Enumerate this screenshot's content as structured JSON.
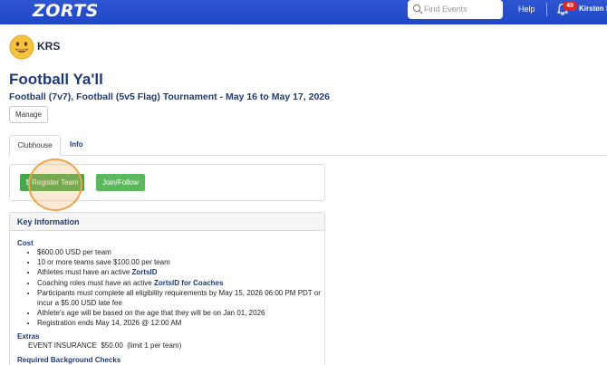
{
  "navbar": {
    "logo_text": "ZORTS",
    "search_placeholder": "Find Events",
    "help_label": "Help",
    "notification_count": "49",
    "username": "Kirsten S",
    "bg_color": "#2649c9"
  },
  "org": {
    "name": "KRS",
    "avatar_icon": "smiley-face-icon"
  },
  "event": {
    "title": "Football Ya'll",
    "subtitle": "Football (7v7), Football (5v5 Flag) Tournament  -  May 16 to May 17, 2026",
    "manage_label": "Manage"
  },
  "tabs": [
    {
      "label": "Clubhouse",
      "active": true
    },
    {
      "label": "Info",
      "active": false
    }
  ],
  "actions": {
    "register_label": "$ Register Team",
    "join_label": "Join/Follow",
    "register_color": "#47a74a",
    "join_color": "#5cb85c"
  },
  "key_info": {
    "title": "Key Information",
    "cost": {
      "label": "Cost",
      "items": [
        {
          "text": "$600.00 USD per team"
        },
        {
          "text": "10 or more teams save $100.00 per team"
        },
        {
          "text": "Athletes must have an active ",
          "link": "ZortsID"
        },
        {
          "text": "Coaching roles must have an active ",
          "link": "ZortsID for Coaches"
        },
        {
          "text": "Participants must complete all eligibility requirements by May 15, 2026 06:00 PM PDT or"
        },
        {
          "text": "incur a $5.00 USD late fee",
          "continuation": true
        },
        {
          "text": "Athlete's age will be based on the age that they will be on Jan 01, 2026"
        },
        {
          "text": "Registration ends May 14, 2026 @ 12:00 AM"
        }
      ]
    },
    "extras": {
      "label": "Extras",
      "line": "EVENT INSURANCE  $50.00  (limit 1 per team)"
    },
    "background_checks": {
      "label": "Required Background Checks"
    }
  }
}
